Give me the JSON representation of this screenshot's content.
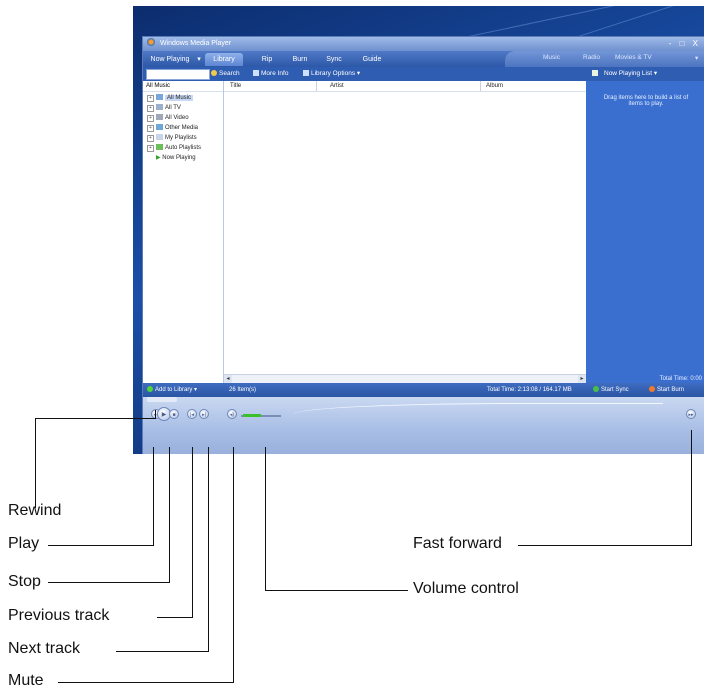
{
  "player": {
    "title": "Windows Media Player",
    "window_buttons": "- □ X",
    "tabs": [
      "Now Playing",
      "Library",
      "Rip",
      "Burn",
      "Sync",
      "Guide"
    ],
    "active_tab": "Library",
    "right_tabs": [
      "Music",
      "Radio",
      "Movies & TV"
    ],
    "toolbar": {
      "search_label": "Search",
      "more_info_label": "More Info",
      "library_options_label": "Library Options",
      "now_playing_list_label": "Now Playing List"
    },
    "left_pane": {
      "header": "All Music",
      "items": [
        "All Music",
        "All TV",
        "All Video",
        "Other Media",
        "My Playlists",
        "Auto Playlists",
        "Now Playing"
      ]
    },
    "columns": [
      "Title",
      "Artist",
      "Album"
    ],
    "now_playing_hint": "Drag items here to build a list of items to play.",
    "total_time_right": "Total Time: 0:00",
    "status": {
      "add_to_library": "Add to Library",
      "item_count": "26 Item(s)",
      "total_time": "Total Time: 2:13:08 / 164.17 MB",
      "start_sync": "Start Sync",
      "start_burn": "Start Burn"
    },
    "accent_colors": {
      "frame_blue": "#2f5db2",
      "volume_green": "#3bbf2a"
    }
  },
  "callouts": {
    "rewind": "Rewind",
    "play": "Play",
    "stop": "Stop",
    "previous_track": "Previous track",
    "next_track": "Next track",
    "mute": "Mute",
    "volume_control": "Volume control",
    "fast_forward": "Fast forward"
  }
}
